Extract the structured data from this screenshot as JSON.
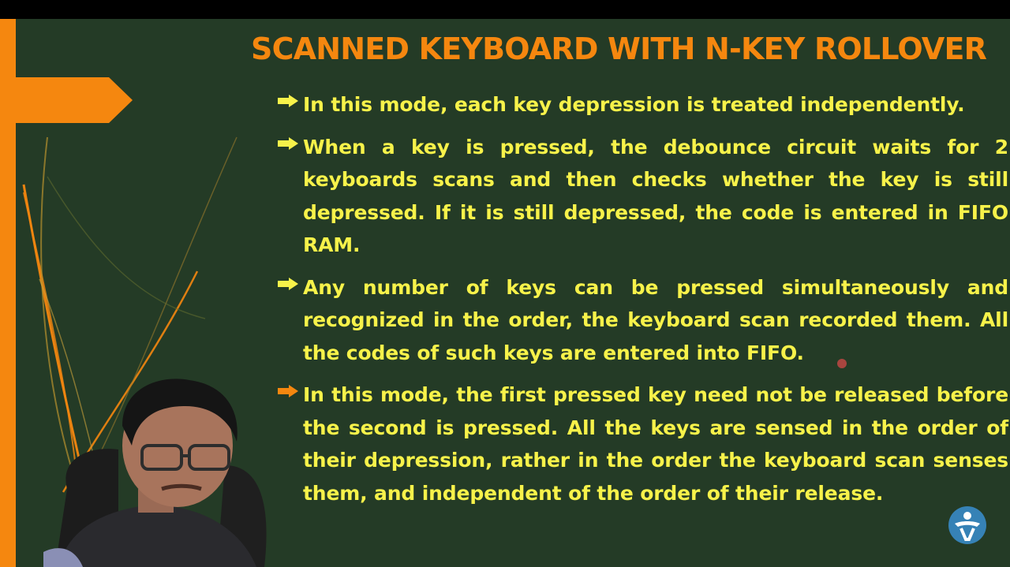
{
  "slide": {
    "title": "SCANNED KEYBOARD WITH N-KEY ROLLOVER",
    "bullets": [
      {
        "text": "In this mode, each key depression is treated independently.",
        "icon": "arrow-bullet-icon"
      },
      {
        "text": "When a key is pressed, the debounce circuit waits for 2 keyboards scans and then checks whether the key is still depressed. If it is still depressed, the code is entered in FIFO RAM.",
        "icon": "arrow-bullet-icon"
      },
      {
        "text": "Any number of keys can be pressed simultaneously and recognized in the order, the keyboard scan recorded them. All the codes of such keys are entered into FIFO.",
        "icon": "arrow-bullet-icon"
      },
      {
        "text": "In this mode, the first pressed key need not be released before the second is pressed. All the keys are sensed in the order of their depression, rather in the order the keyboard scan senses them, and independent of the order of their release.",
        "icon": "arrow-bullet-icon"
      }
    ]
  },
  "colors": {
    "background": "#243b26",
    "title": "#f5870f",
    "bullet_text": "#f7f24a",
    "accent": "#f5870f",
    "bullet_icon_yellow": "#f7f24a",
    "bullet_icon_orange": "#f5870f"
  },
  "icons": [
    "arrow-tab-icon",
    "arrow-bullet-icon",
    "channel-logo-icon"
  ]
}
